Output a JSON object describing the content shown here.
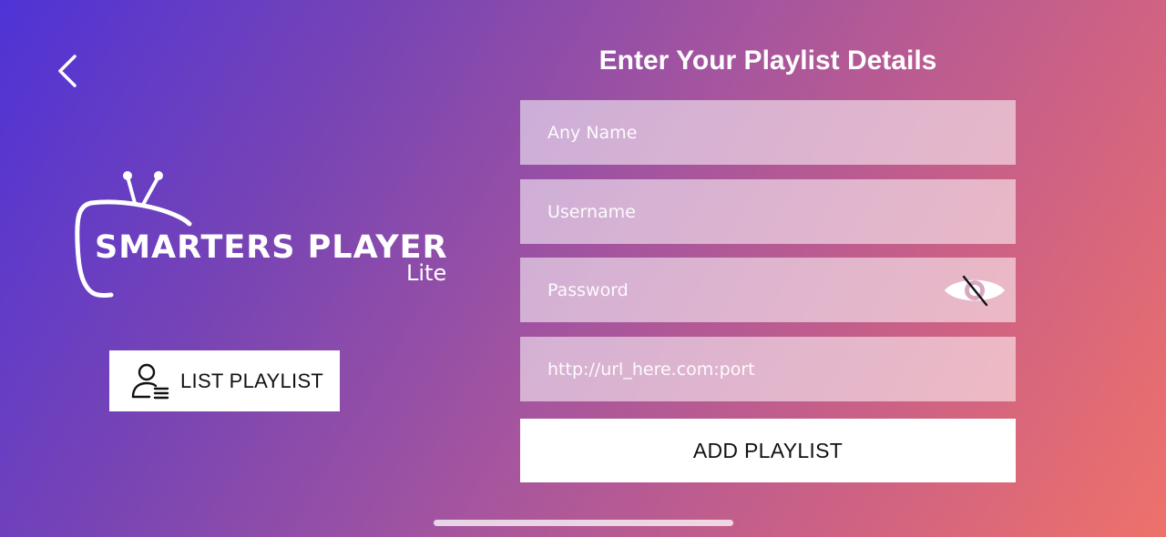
{
  "navigation": {
    "back_icon": "chevron-left-icon"
  },
  "logo": {
    "title": "SMARTERS PLAYER",
    "subtitle": "Lite",
    "icon": "tv-antenna-icon"
  },
  "sidebar": {
    "list_playlist_label": "LIST PLAYLIST",
    "list_playlist_icon": "user-list-icon"
  },
  "form": {
    "title": "Enter Your Playlist Details",
    "fields": {
      "name": {
        "placeholder": "Any Name",
        "value": ""
      },
      "username": {
        "placeholder": "Username",
        "value": ""
      },
      "password": {
        "placeholder": "Password",
        "value": "",
        "toggle_icon": "eye-slash-icon"
      },
      "url": {
        "placeholder": "http://url_here.com:port",
        "value": ""
      }
    },
    "submit_label": "ADD PLAYLIST"
  },
  "colors": {
    "gradient_start": "#4f33d6",
    "gradient_end": "#ee726a",
    "field_background": "rgba(255,255,255,0.55)",
    "button_background": "#ffffff"
  }
}
